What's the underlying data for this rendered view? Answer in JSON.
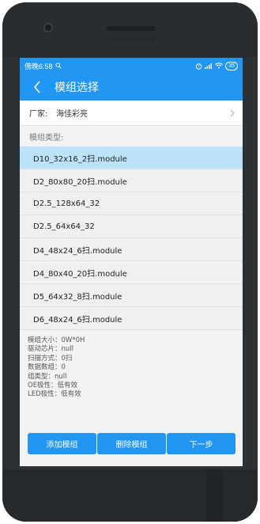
{
  "status": {
    "time": "傍晚6:58",
    "battery": "35"
  },
  "appbar": {
    "title": "模组选择"
  },
  "factory": {
    "label": "厂家:",
    "value": "海佳彩亮"
  },
  "type_label": "模组类型:",
  "modules": [
    {
      "label": "D10_32x16_2扫.module",
      "selected": true
    },
    {
      "label": "D2_80x80_20扫.module",
      "selected": false
    },
    {
      "label": "D2.5_128x64_32",
      "selected": false
    },
    {
      "label": "D2.5_64x64_32",
      "selected": false
    },
    {
      "label": "D4_48x24_6扫.module",
      "selected": false
    },
    {
      "label": "D4_80x40_20扫.module",
      "selected": false
    },
    {
      "label": "D5_64x32_8扫.module",
      "selected": false
    },
    {
      "label": "D6_48x24_6扫.module",
      "selected": false
    }
  ],
  "info": {
    "size": "模组大小：0W*0H",
    "chip": "驱动芯片：null",
    "scan": "扫描方式：0扫",
    "data_groups": "数据数组：0",
    "group_type": "组类型：null",
    "oe": "OE极性：低有效",
    "led": "LED极性：低有效"
  },
  "buttons": {
    "add": "添加模组",
    "delete": "删除模组",
    "next": "下一步"
  },
  "colors": {
    "accent": "#2196f3",
    "selected_row": "#bde3fb"
  }
}
